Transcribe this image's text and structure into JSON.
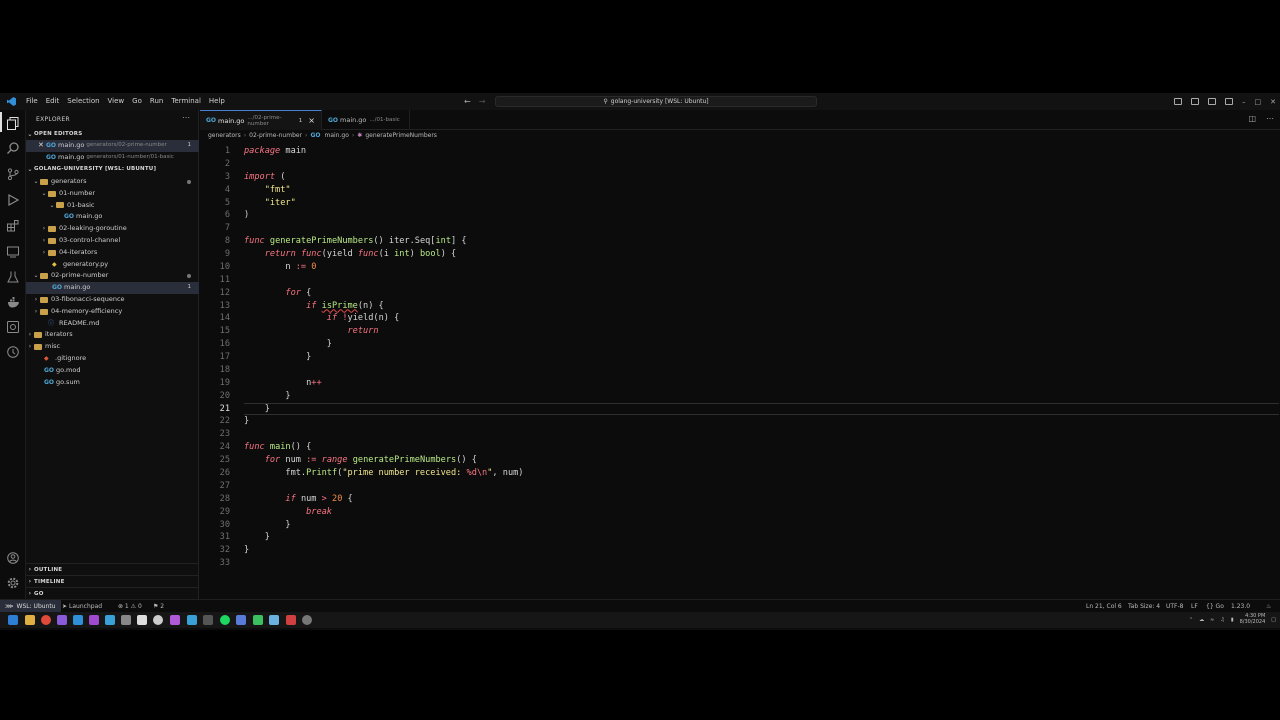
{
  "titlebar": {
    "menus": [
      "File",
      "Edit",
      "Selection",
      "View",
      "Go",
      "Run",
      "Terminal",
      "Help"
    ],
    "search": "golang-university [WSL: Ubuntu]"
  },
  "sidebar": {
    "title": "EXPLORER",
    "open_editors_label": "OPEN EDITORS",
    "open_editors": [
      {
        "name": "main.go",
        "path": "generators/02-prime-number",
        "badge": "1"
      },
      {
        "name": "main.go",
        "path": "generators/01-number/01-basic",
        "badge": ""
      }
    ],
    "workspace_label": "GOLANG-UNIVERSITY [WSL: UBUNTU]",
    "tree": [
      {
        "label": "generators"
      },
      {
        "label": "01-number"
      },
      {
        "label": "01-basic"
      },
      {
        "label": "main.go"
      },
      {
        "label": "02-leaking-goroutine"
      },
      {
        "label": "03-control-channel"
      },
      {
        "label": "04-iterators"
      },
      {
        "label": "generatory.py"
      },
      {
        "label": "02-prime-number"
      },
      {
        "label": "main.go",
        "badge": "1"
      },
      {
        "label": "03-fibonacci-sequence"
      },
      {
        "label": "04-memory-efficiency"
      },
      {
        "label": "README.md"
      },
      {
        "label": "iterators"
      },
      {
        "label": "misc"
      },
      {
        "label": ".gitignore"
      },
      {
        "label": "go.mod"
      },
      {
        "label": "go.sum"
      }
    ],
    "outline_label": "OUTLINE",
    "timeline_label": "TIMELINE",
    "go_label": "GO"
  },
  "tabs": [
    {
      "name": "main.go",
      "path": ".../02-prime-number",
      "problems": "1"
    },
    {
      "name": "main.go",
      "path": ".../01-basic"
    }
  ],
  "breadcrumb": [
    "generators",
    "02-prime-number",
    "main.go",
    "generatePrimeNumbers"
  ],
  "editor": {
    "current_line": 21,
    "lines": [
      "package main",
      "",
      "import (",
      "\t\"fmt\"",
      "\t\"iter\"",
      ")",
      "",
      "func generatePrimeNumbers() iter.Seq[int] {",
      "\treturn func(yield func(i int) bool) {",
      "\t\tn := 0",
      "",
      "\t\tfor {",
      "\t\t\tif isPrime(n) {",
      "\t\t\t\tif !yield(n) {",
      "\t\t\t\t\treturn",
      "\t\t\t\t}",
      "\t\t\t}",
      "",
      "\t\t\tn++",
      "\t\t}",
      "\t}",
      "}",
      "",
      "func main() {",
      "\tfor num := range generatePrimeNumbers() {",
      "\t\tfmt.Printf(\"prime number received: %d\\n\", num)",
      "",
      "\t\tif num > 20 {",
      "\t\t\tbreak",
      "\t\t}",
      "\t}",
      "}",
      ""
    ]
  },
  "status": {
    "remote": "WSL: Ubuntu",
    "launchpad": "Launchpad",
    "problems": "⊗ 1 ⚠ 0",
    "ports": "⚑ 2",
    "cursor": "Ln 21, Col 6",
    "tab_size": "Tab Size: 4",
    "encoding": "UTF-8",
    "eol": "LF",
    "language": "{} Go",
    "go_version": "1.23.0"
  },
  "taskbar": {
    "time": "4:30 PM",
    "date": "8/30/2024"
  }
}
